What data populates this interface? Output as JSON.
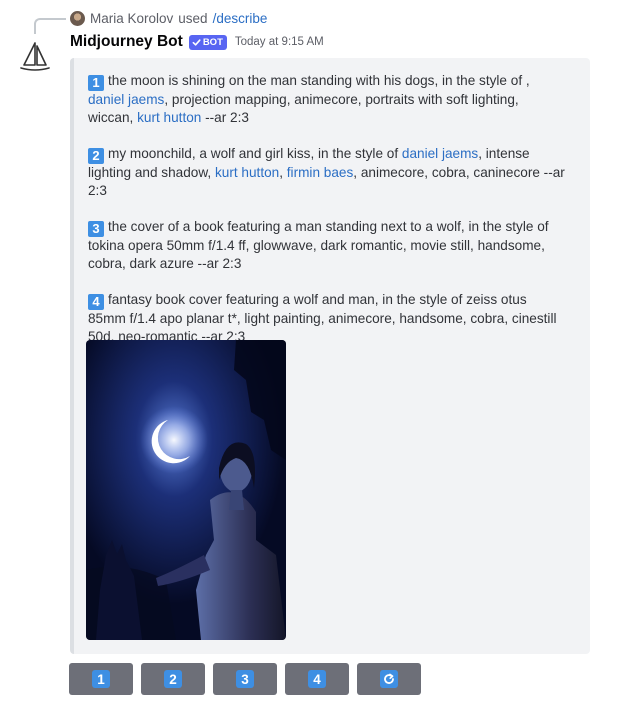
{
  "reply": {
    "user": "Maria Korolov",
    "used_text": "used",
    "command": "/describe"
  },
  "message": {
    "author": "Midjourney Bot",
    "bot_tag": "BOT",
    "timestamp": "Today at 9:15 AM"
  },
  "prompts": [
    {
      "num": "1",
      "segments": [
        {
          "text": "the moon is shining on the man standing with his dogs, in the style of , "
        },
        {
          "text": "daniel jaems",
          "link": true
        },
        {
          "text": ", projection mapping, animecore, portraits with soft lighting, wiccan, "
        },
        {
          "text": "kurt hutton",
          "link": true
        },
        {
          "text": " --ar 2:3"
        }
      ]
    },
    {
      "num": "2",
      "segments": [
        {
          "text": "my moonchild, a wolf and girl kiss, in the style of "
        },
        {
          "text": "daniel jaems",
          "link": true
        },
        {
          "text": ", intense lighting and shadow, "
        },
        {
          "text": "kurt hutton",
          "link": true
        },
        {
          "text": ", "
        },
        {
          "text": "firmin baes",
          "link": true
        },
        {
          "text": ", animecore, cobra, caninecore --ar 2:3"
        }
      ]
    },
    {
      "num": "3",
      "segments": [
        {
          "text": "the cover of a book featuring a man standing next to a wolf, in the style of tokina opera 50mm f/1.4 ff, glowwave, dark romantic, movie still, handsome, cobra, dark azure --ar 2:3"
        }
      ]
    },
    {
      "num": "4",
      "segments": [
        {
          "text": "fantasy book cover featuring a wolf and man, in the style of zeiss otus 85mm f/1.4 apo planar t*, light painting, animecore, handsome, cobra, cinestill 50d, neo-romantic --ar 2:3"
        }
      ]
    }
  ],
  "buttons": [
    {
      "label": "1"
    },
    {
      "label": "2"
    },
    {
      "label": "3"
    },
    {
      "label": "4"
    },
    {
      "icon": "refresh-icon"
    }
  ],
  "colors": {
    "link": "#2b6ec4",
    "number_badge": "#3e8fe3",
    "button_bg": "#6d6f78",
    "bot_tag": "#5865f2",
    "embed_bg": "#f2f3f5"
  }
}
